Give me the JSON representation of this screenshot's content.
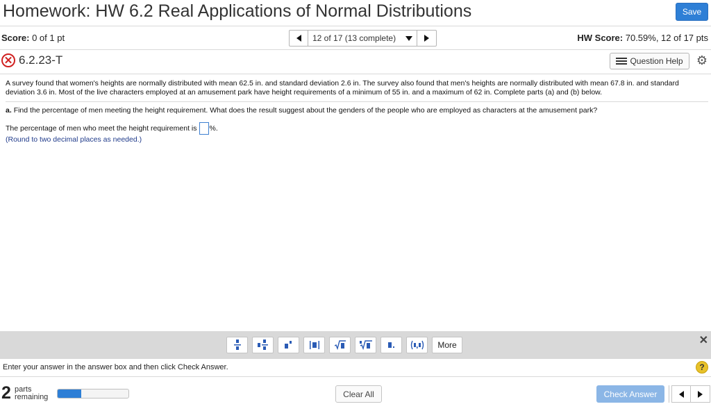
{
  "header": {
    "title": "Homework: HW 6.2 Real Applications of Normal Distributions",
    "save_label": "Save"
  },
  "status": {
    "score_label": "Score:",
    "score_value": "0 of 1 pt",
    "question_selector": "12 of 17 (13 complete)",
    "hw_score_label": "HW Score:",
    "hw_score_value": "70.59%, 12 of 17 pts"
  },
  "question": {
    "id": "6.2.23-T",
    "status_icon": "x-circle-icon",
    "help_label": "Question Help",
    "problem_text": "A survey found that women's heights are normally distributed with mean 62.5 in. and standard deviation 2.6 in. The survey also found that men's heights are normally distributed with mean 67.8 in. and standard deviation 3.6 in. Most of the live characters employed at an amusement park have height requirements of a minimum of 55 in. and a maximum of 62 in. Complete parts (a) and (b) below.",
    "part_a_label": "a.",
    "part_a_text": "Find the percentage of men meeting the height requirement. What does the result suggest about the genders of the people who are employed as characters at the amusement park?",
    "answer_prefix": "The percentage of men who meet the height requirement is",
    "answer_suffix": "%.",
    "answer_value": "",
    "hint": "(Round to two decimal places as needed.)"
  },
  "toolbar": {
    "tools": [
      "fraction-icon",
      "mixed-number-icon",
      "exponent-icon",
      "absolute-value-icon",
      "sqrt-icon",
      "nth-root-icon",
      "decimal-icon",
      "interval-icon"
    ],
    "more_label": "More"
  },
  "footer": {
    "instructions": "Enter your answer in the answer box and then click Check Answer.",
    "parts_count": "2",
    "parts_line1": "parts",
    "parts_line2": "remaining",
    "progress_fraction": 0.33,
    "clear_label": "Clear All",
    "check_label": "Check Answer"
  },
  "colors": {
    "accent": "#2e7fd6",
    "error": "#d02020",
    "hint": "#1f3a8a",
    "toolbar_bg": "#d9d9d9"
  }
}
